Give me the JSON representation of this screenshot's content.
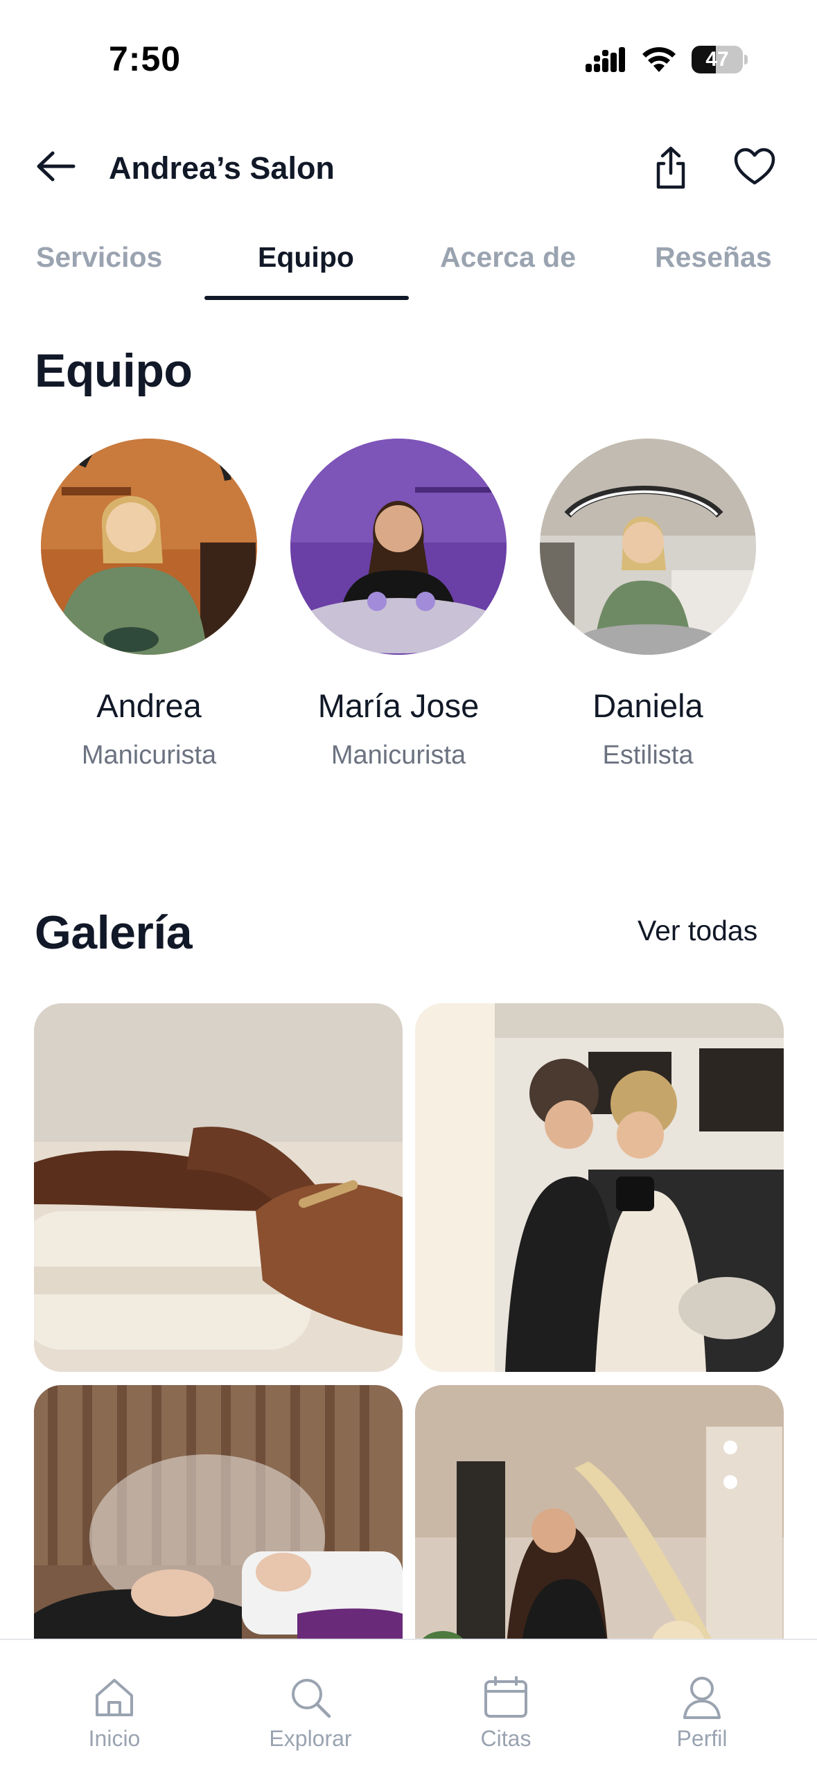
{
  "status_bar": {
    "time": "7:50",
    "battery": "47",
    "battery_level": 0.47
  },
  "header": {
    "title": "Andrea’s Salon"
  },
  "tabs": [
    {
      "label": "Servicios",
      "active": false
    },
    {
      "label": "Equipo",
      "active": true
    },
    {
      "label": "Acerca de",
      "active": false
    },
    {
      "label": "Reseñas",
      "active": false
    }
  ],
  "team": {
    "title": "Equipo",
    "members": [
      {
        "name": "Andrea",
        "role": "Manicurista"
      },
      {
        "name": "María Jose",
        "role": "Manicurista"
      },
      {
        "name": "Daniela",
        "role": "Estilista"
      }
    ]
  },
  "gallery": {
    "title": "Galería",
    "see_all": "Ver todas"
  },
  "bottom_nav": [
    {
      "label": "Inicio",
      "icon": "home-icon"
    },
    {
      "label": "Explorar",
      "icon": "search-icon"
    },
    {
      "label": "Citas",
      "icon": "calendar-icon"
    },
    {
      "label": "Perfil",
      "icon": "user-icon"
    }
  ],
  "colors": {
    "text_primary": "#111827",
    "text_muted": "#9aa3b0",
    "text_secondary": "#6b7280",
    "indicator": "#111827"
  }
}
